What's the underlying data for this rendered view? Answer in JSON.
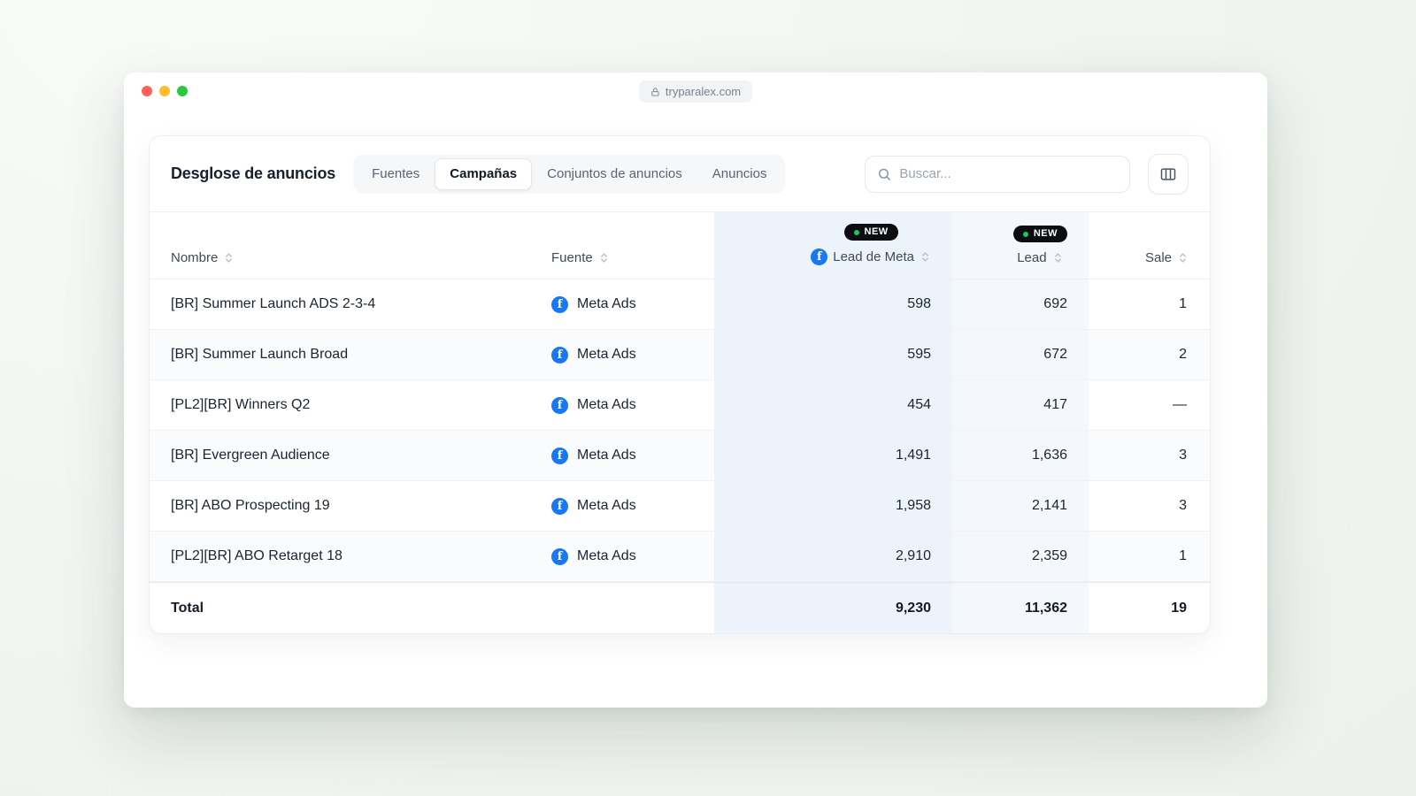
{
  "window": {
    "url": "tryparalex.com"
  },
  "panel": {
    "title": "Desglose de anuncios",
    "tabs": [
      {
        "label": "Fuentes",
        "active": false
      },
      {
        "label": "Campañas",
        "active": true
      },
      {
        "label": "Conjuntos de anuncios",
        "active": false
      },
      {
        "label": "Anuncios",
        "active": false
      }
    ],
    "search_placeholder": "Buscar..."
  },
  "table": {
    "badge_new": "NEW",
    "headers": {
      "name": "Nombre",
      "source": "Fuente",
      "lead_meta": "Lead de Meta",
      "lead": "Lead",
      "sale": "Sale"
    },
    "rows": [
      {
        "name": "[BR] Summer Launch ADS 2-3-4",
        "source": "Meta Ads",
        "lead_meta": "598",
        "lead": "692",
        "sale": "1"
      },
      {
        "name": "[BR] Summer Launch Broad",
        "source": "Meta Ads",
        "lead_meta": "595",
        "lead": "672",
        "sale": "2"
      },
      {
        "name": "[PL2][BR] Winners Q2",
        "source": "Meta Ads",
        "lead_meta": "454",
        "lead": "417",
        "sale": "—"
      },
      {
        "name": "[BR] Evergreen Audience",
        "source": "Meta Ads",
        "lead_meta": "1,491",
        "lead": "1,636",
        "sale": "3"
      },
      {
        "name": "[BR] ABO Prospecting 19",
        "source": "Meta Ads",
        "lead_meta": "1,958",
        "lead": "2,141",
        "sale": "3"
      },
      {
        "name": "[PL2][BR] ABO Retarget 18",
        "source": "Meta Ads",
        "lead_meta": "2,910",
        "lead": "2,359",
        "sale": "1"
      }
    ],
    "total": {
      "label": "Total",
      "lead_meta": "9,230",
      "lead": "11,362",
      "sale": "19"
    }
  },
  "colors": {
    "facebook_blue": "#1877f2",
    "badge_bg": "#0b0d11",
    "badge_dot_green": "#22c55e",
    "highlight_lead_meta": "#edf3fa",
    "highlight_lead": "#f4f8fc"
  }
}
